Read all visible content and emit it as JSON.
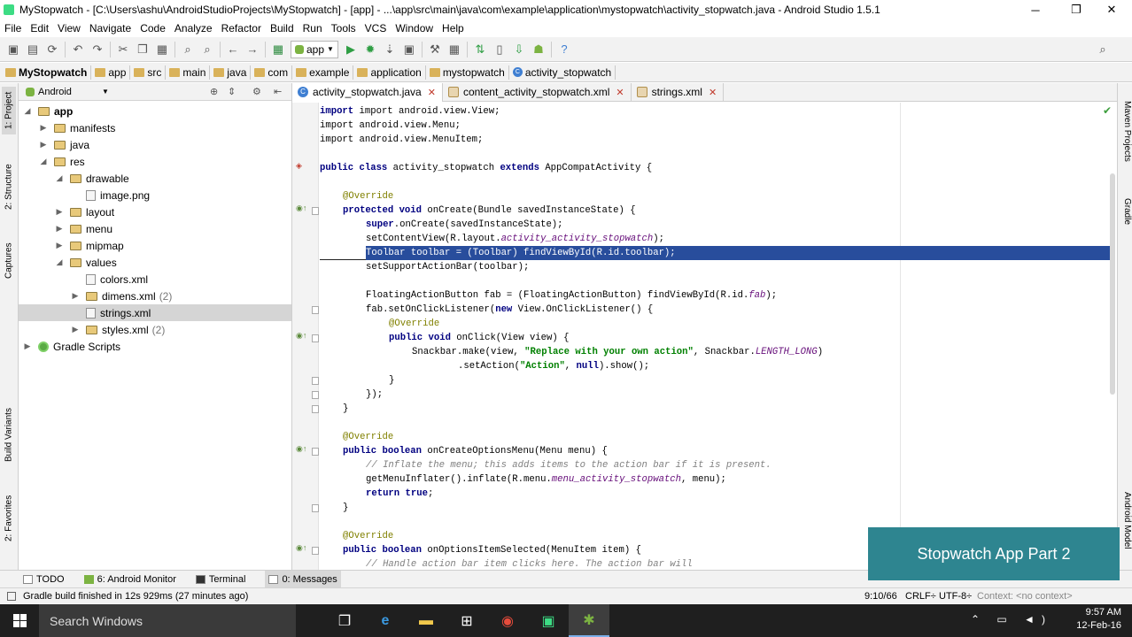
{
  "titlebar": {
    "title": "MyStopwatch - [C:\\Users\\ashu\\AndroidStudioProjects\\MyStopwatch] - [app] - ...\\app\\src\\main\\java\\com\\example\\application\\mystopwatch\\activity_stopwatch.java - Android Studio 1.5.1",
    "minimize": "─",
    "maximize": "❐",
    "close": "✕"
  },
  "menu": [
    "File",
    "Edit",
    "View",
    "Navigate",
    "Code",
    "Analyze",
    "Refactor",
    "Build",
    "Run",
    "Tools",
    "VCS",
    "Window",
    "Help"
  ],
  "toolbar": {
    "run_config": "app"
  },
  "breadcrumb": [
    "MyStopwatch",
    "app",
    "src",
    "main",
    "java",
    "com",
    "example",
    "application",
    "mystopwatch",
    "activity_stopwatch"
  ],
  "left_tabs": [
    "1: Project",
    "2: Structure",
    "Captures",
    "Build Variants",
    "2: Favorites"
  ],
  "right_tabs": [
    "Maven Projects",
    "Gradle",
    "Android Model"
  ],
  "project": {
    "view_selector": "Android",
    "tree": [
      {
        "label": "app",
        "count": ""
      },
      {
        "label": "manifests",
        "count": ""
      },
      {
        "label": "java",
        "count": ""
      },
      {
        "label": "res",
        "count": ""
      },
      {
        "label": "drawable",
        "count": ""
      },
      {
        "label": "image.png",
        "count": ""
      },
      {
        "label": "layout",
        "count": ""
      },
      {
        "label": "menu",
        "count": ""
      },
      {
        "label": "mipmap",
        "count": ""
      },
      {
        "label": "values",
        "count": ""
      },
      {
        "label": "colors.xml",
        "count": ""
      },
      {
        "label": "dimens.xml",
        "count": "(2)"
      },
      {
        "label": "strings.xml",
        "count": ""
      },
      {
        "label": "styles.xml",
        "count": "(2)"
      },
      {
        "label": "Gradle Scripts",
        "count": ""
      }
    ]
  },
  "editor_tabs": [
    "activity_stopwatch.java",
    "content_activity_stopwatch.xml",
    "strings.xml"
  ],
  "code": {
    "l01": "import android.view.View;",
    "l02": "import android.view.Menu;",
    "l03": "import android.view.MenuItem;",
    "l04_k": "public class",
    "l04_t": " activity_stopwatch ",
    "l04_k2": "extends",
    "l04_t2": " AppCompatActivity {",
    "l05": "@Override",
    "l06_k": "protected void",
    "l06_t": " onCreate(Bundle savedInstanceState) {",
    "l07_k": "super",
    "l07_t": ".onCreate(savedInstanceState);",
    "l08_a": "setContentView(R.layout.",
    "l08_f": "activity_activity_stopwatch",
    "l08_b": ");",
    "l09": "Toolbar toolbar = (Toolbar) findViewById(R.id.toolbar);",
    "l10": "setSupportActionBar(toolbar);",
    "l11_a": "FloatingActionButton fab = (FloatingActionButton) findViewById(R.id.",
    "l11_f": "fab",
    "l11_b": ");",
    "l12_a": "fab.setOnClickListener(",
    "l12_k": "new",
    "l12_b": " View.OnClickListener() {",
    "l13": "@Override",
    "l14_k": "public void",
    "l14_t": " onClick(View view) {",
    "l15_a": "Snackbar.make(view, ",
    "l15_s": "\"Replace with your own action\"",
    "l15_b": ", Snackbar.",
    "l15_f": "LENGTH_LONG",
    "l15_c": ")",
    "l16_a": ".setAction(",
    "l16_s": "\"Action\"",
    "l16_b": ", ",
    "l16_k": "null",
    "l16_c": ").show();",
    "l17": "}",
    "l18": "});",
    "l19": "}",
    "l20": "@Override",
    "l21_k": "public boolean",
    "l21_t": " onCreateOptionsMenu(Menu menu) {",
    "l22": "// Inflate the menu; this adds items to the action bar if it is present.",
    "l23_a": "getMenuInflater().inflate(R.menu.",
    "l23_f": "menu_activity_stopwatch",
    "l23_b": ", menu);",
    "l24_k": "return true",
    "l24_t": ";",
    "l25": "}",
    "l26": "@Override",
    "l27_k": "public boolean",
    "l27_t": " onOptionsItemSelected(MenuItem item) {",
    "l28": "// Handle action bar item clicks here. The action bar will"
  },
  "bottom_tabs": [
    "TODO",
    "6: Android Monitor",
    "Terminal",
    "0: Messages"
  ],
  "status": {
    "message": "Gradle build finished in 12s 929ms (27 minutes ago)",
    "position": "9:10/66",
    "line_sep": "CRLF÷",
    "encoding": "UTF-8÷",
    "context": "Context: <no context>"
  },
  "overlay": "Stopwatch App Part 2",
  "taskbar": {
    "search": "Search Windows",
    "time": "9:57 AM",
    "date": "12-Feb-16"
  }
}
